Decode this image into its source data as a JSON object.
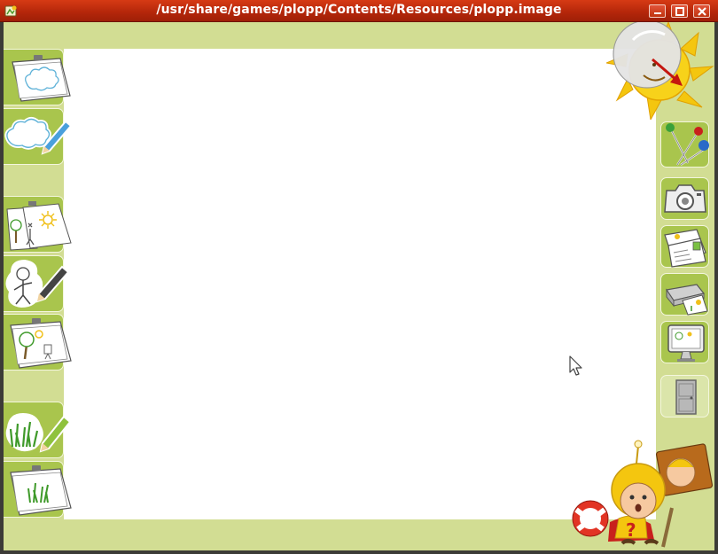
{
  "window": {
    "title": "/usr/share/games/plopp/Contents/Resources/plopp.image",
    "icon": "plopp-app-icon",
    "buttons": [
      "minimize",
      "maximize",
      "close"
    ]
  },
  "left_tools": [
    {
      "name": "cloud-page",
      "icon": "clipboard-cloud-icon"
    },
    {
      "name": "cloud-pencil",
      "icon": "cloud-pencil-icon"
    },
    {
      "name": "scene-pages",
      "icon": "scene-pages-icon"
    },
    {
      "name": "figure-pencil",
      "icon": "figure-pencil-icon"
    },
    {
      "name": "tree-page",
      "icon": "clipboard-tree-icon"
    },
    {
      "name": "grass-pencil",
      "icon": "grass-pencil-icon"
    },
    {
      "name": "grass-page",
      "icon": "clipboard-grass-icon"
    }
  ],
  "right_actions": [
    {
      "name": "pins",
      "icon": "pins-icon"
    },
    {
      "name": "camera",
      "icon": "camera-icon"
    },
    {
      "name": "postcard",
      "icon": "postcard-icon"
    },
    {
      "name": "printer",
      "icon": "printer-icon"
    },
    {
      "name": "monitor",
      "icon": "monitor-icon"
    },
    {
      "name": "door",
      "icon": "door-icon",
      "enabled": false
    }
  ],
  "colors": {
    "titlebar": "#c02f0e",
    "panel": "#d2dd93",
    "button": "#a9c54d",
    "canvas": "#ffffff"
  }
}
